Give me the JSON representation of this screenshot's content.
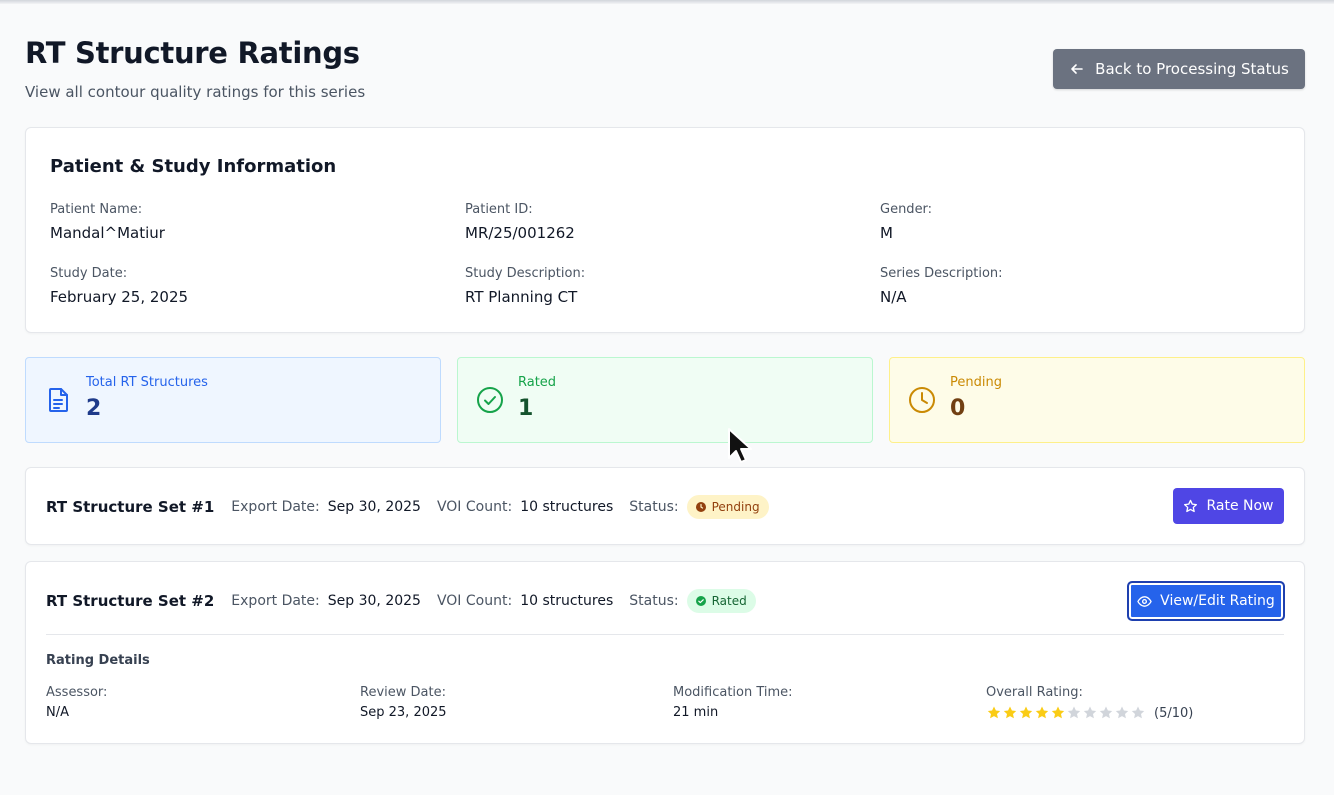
{
  "header": {
    "title": "RT Structure Ratings",
    "subtitle": "View all contour quality ratings for this series",
    "back_label": "Back to Processing Status"
  },
  "patient_info": {
    "title": "Patient & Study Information",
    "fields": [
      {
        "label": "Patient Name:",
        "value": "Mandal^Matiur"
      },
      {
        "label": "Patient ID:",
        "value": "MR/25/001262"
      },
      {
        "label": "Gender:",
        "value": "M"
      },
      {
        "label": "Study Date:",
        "value": "February 25, 2025"
      },
      {
        "label": "Study Description:",
        "value": "RT Planning CT"
      },
      {
        "label": "Series Description:",
        "value": "N/A"
      }
    ]
  },
  "stats": [
    {
      "label": "Total RT Structures",
      "value": "2",
      "icon": "document-icon",
      "color": "#2563eb"
    },
    {
      "label": "Rated",
      "value": "1",
      "icon": "check-circle-icon",
      "color": "#16a34a"
    },
    {
      "label": "Pending",
      "value": "0",
      "icon": "clock-icon",
      "color": "#ca8a04"
    }
  ],
  "structure_sets": [
    {
      "name": "RT Structure Set #1",
      "export_label": "Export Date:",
      "export_date": "Sep 30, 2025",
      "voi_label": "VOI Count:",
      "voi_count": "10 structures",
      "status_label": "Status:",
      "status": "Pending",
      "action": "Rate Now"
    },
    {
      "name": "RT Structure Set #2",
      "export_label": "Export Date:",
      "export_date": "Sep 30, 2025",
      "voi_label": "VOI Count:",
      "voi_count": "10 structures",
      "status_label": "Status:",
      "status": "Rated",
      "action": "View/Edit Rating",
      "rating_details": {
        "title": "Rating Details",
        "assessor_label": "Assessor:",
        "assessor": "N/A",
        "review_date_label": "Review Date:",
        "review_date": "Sep 23, 2025",
        "modification_label": "Modification Time:",
        "modification_time": "21 min",
        "overall_label": "Overall Rating:",
        "overall_rating": 5,
        "overall_max": 10,
        "overall_text": "(5/10)"
      }
    }
  ]
}
